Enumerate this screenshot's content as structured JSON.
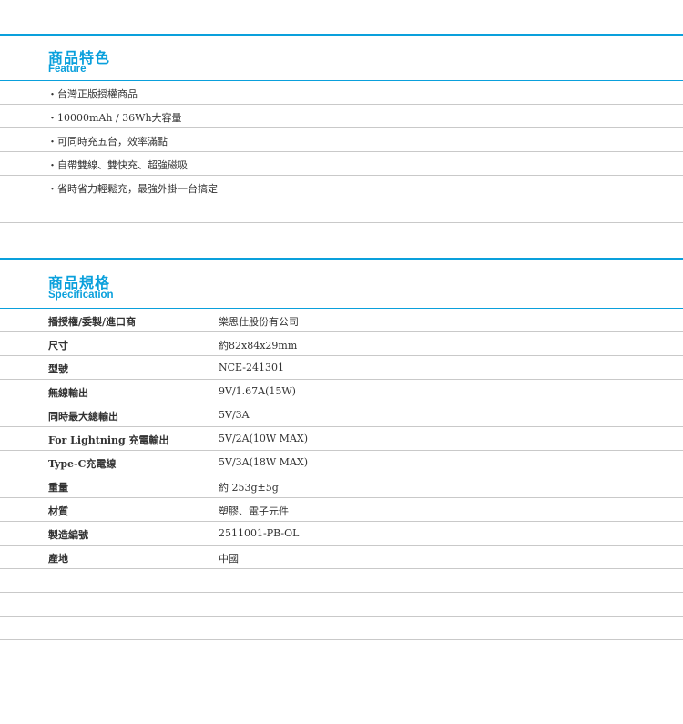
{
  "feature": {
    "title_zh": "商品特色",
    "title_en": "Feature",
    "items": [
      "・台灣正版授權商品",
      "・10000mAh / 36Wh大容量",
      "・可同時充五台，效率滿點",
      "・自帶雙線、雙快充、超強磁吸",
      "・省時省力輕鬆充，最強外掛一台搞定"
    ]
  },
  "spec": {
    "title_zh": "商品規格",
    "title_en": "Specification",
    "rows": [
      {
        "label": "播授權/委製/進口商",
        "value": "樂恩仕股份有公司"
      },
      {
        "label": "尺寸",
        "value": "約82x84x29mm"
      },
      {
        "label": "型號",
        "value": "NCE-241301"
      },
      {
        "label": "無線輸出",
        "value": "9V/1.67A(15W)"
      },
      {
        "label": "同時最大總輸出",
        "value": "5V/3A"
      },
      {
        "label": "For Lightning 充電輸出",
        "value": "5V/2A(10W MAX)"
      },
      {
        "label": "Type-C充電線",
        "value": "5V/3A(18W MAX)"
      },
      {
        "label": "重量",
        "value": "約 253g±5g"
      },
      {
        "label": "材質",
        "value": "塑膠、電子元件"
      },
      {
        "label": "製造編號",
        "value": "2511001-PB-OL"
      },
      {
        "label": "產地",
        "value": "中國"
      }
    ]
  }
}
